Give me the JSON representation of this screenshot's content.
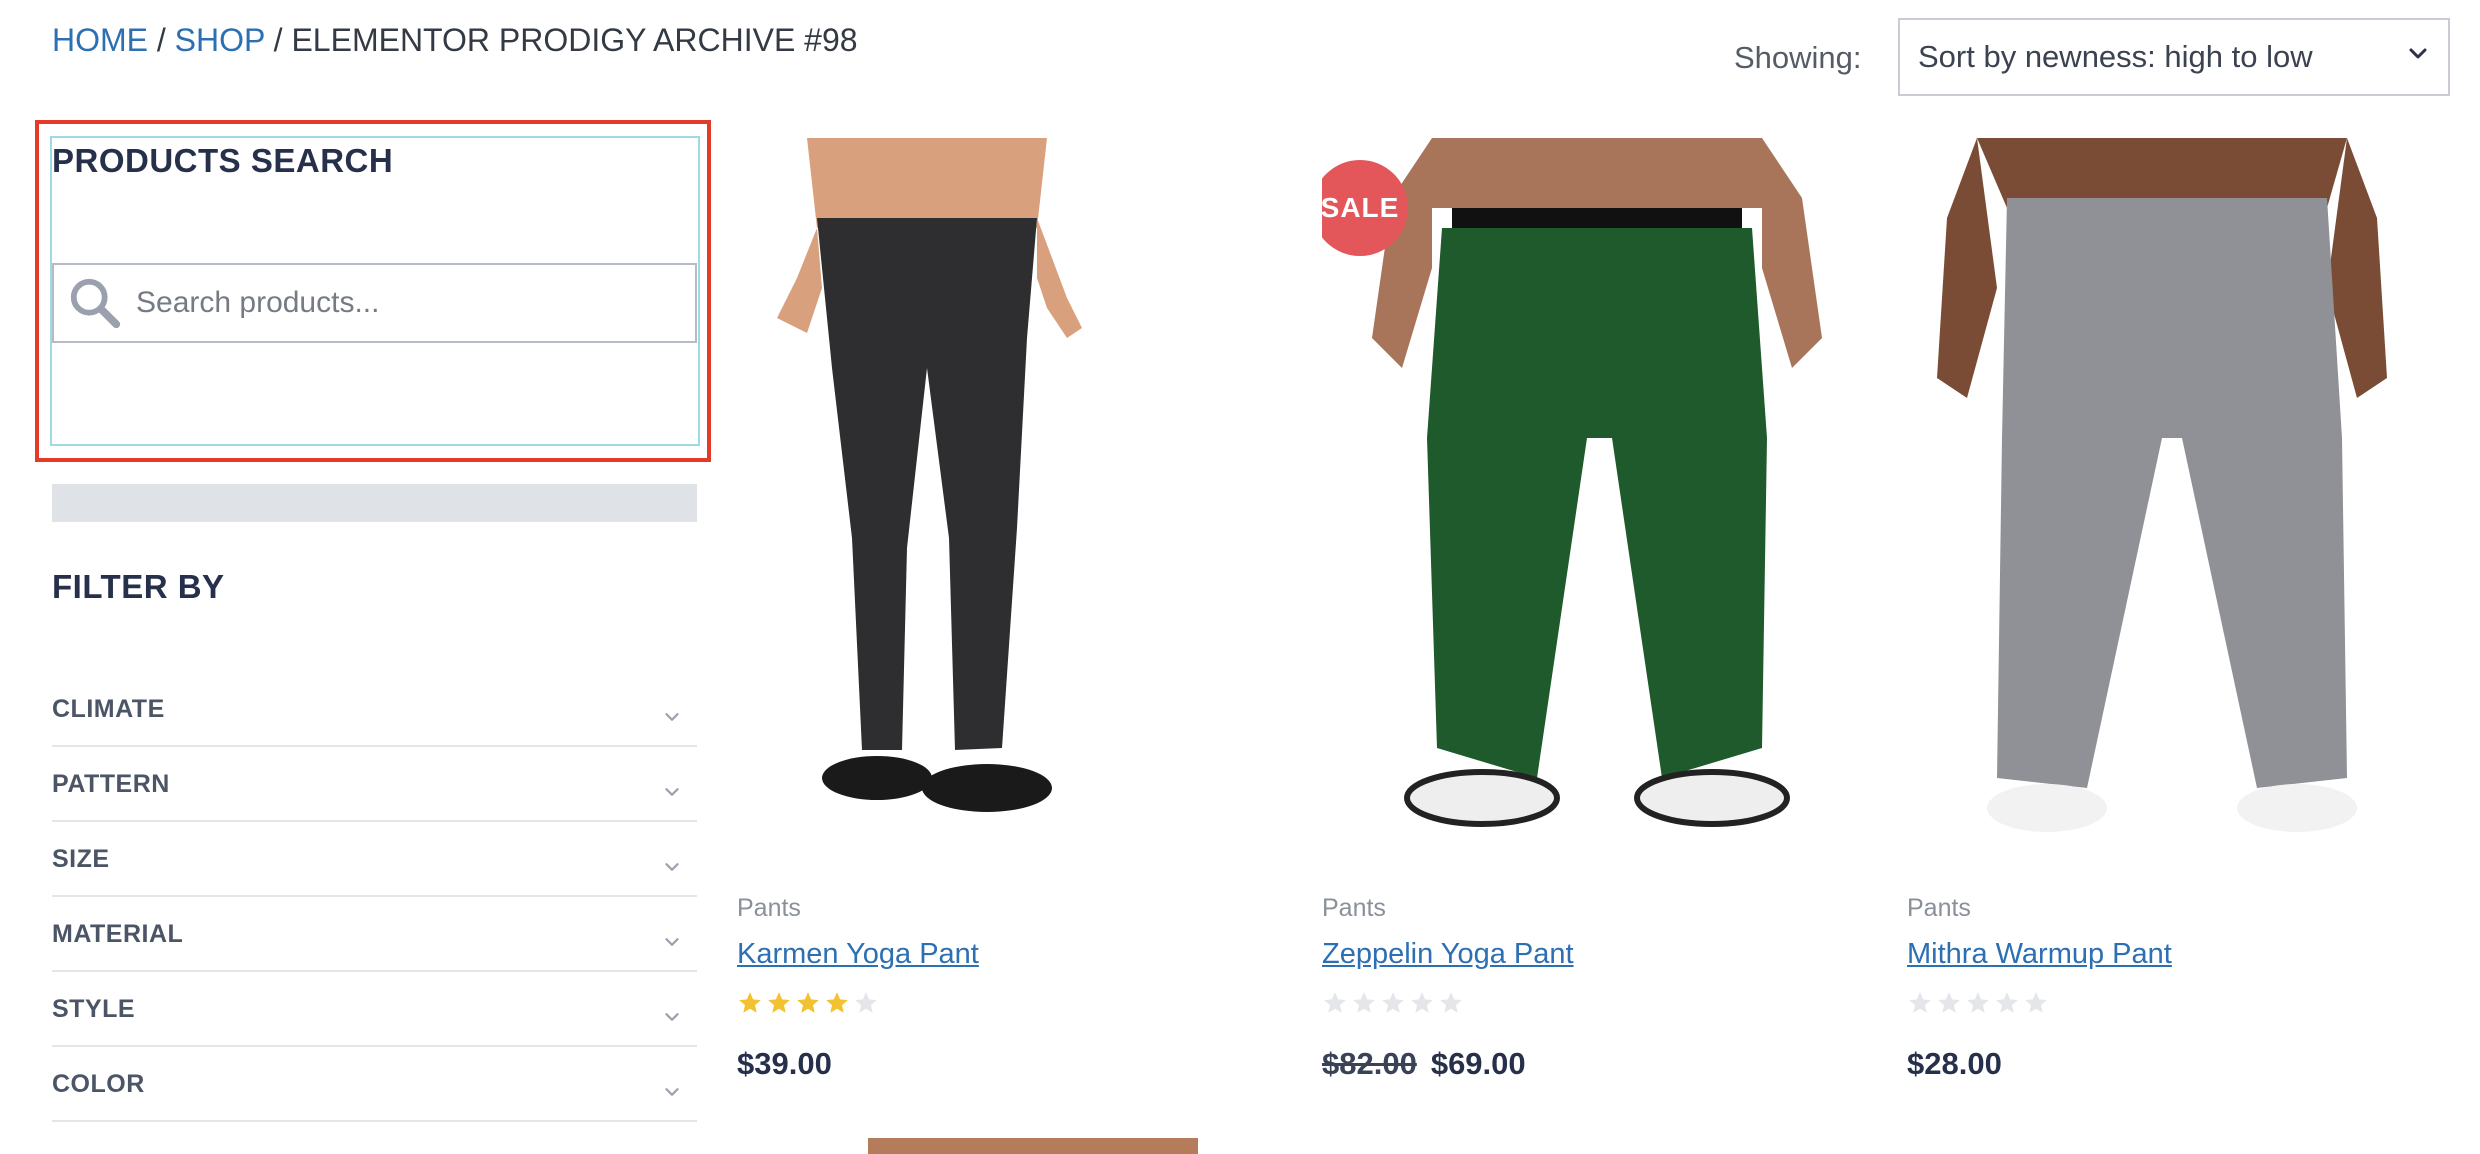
{
  "breadcrumb": {
    "home": "HOME",
    "shop": "SHOP",
    "separator": "/",
    "current": "ELEMENTOR PRODIGY ARCHIVE #98"
  },
  "sort": {
    "label": "Showing:",
    "selected": "Sort by newness: high to low"
  },
  "search_widget": {
    "title": "PRODUCTS SEARCH",
    "placeholder": "Search products...",
    "icon": "search-icon"
  },
  "filters": {
    "title": "FILTER BY",
    "items": [
      {
        "label": "CLIMATE"
      },
      {
        "label": "PATTERN"
      },
      {
        "label": "SIZE"
      },
      {
        "label": "MATERIAL"
      },
      {
        "label": "STYLE"
      },
      {
        "label": "COLOR"
      }
    ]
  },
  "products": [
    {
      "category": "Pants",
      "name": "Karmen Yoga Pant",
      "rating": 4,
      "price": "$39.00",
      "sale": false,
      "pant_color": "#2e2e30"
    },
    {
      "category": "Pants",
      "name": "Zeppelin Yoga Pant",
      "rating": 0,
      "old_price": "$82.00",
      "price": "$69.00",
      "sale": true,
      "sale_label": "SALE",
      "pant_color": "#1f5a2c"
    },
    {
      "category": "Pants",
      "name": "Mithra Warmup Pant",
      "rating": 0,
      "price": "$28.00",
      "sale": false,
      "pant_color": "#8f9197"
    }
  ],
  "colors": {
    "link": "#2c6fb3",
    "star_filled": "#f2c230",
    "star_empty": "#e4e6ea",
    "sale_badge": "#e3575a",
    "highlight": "#e53a2a"
  }
}
